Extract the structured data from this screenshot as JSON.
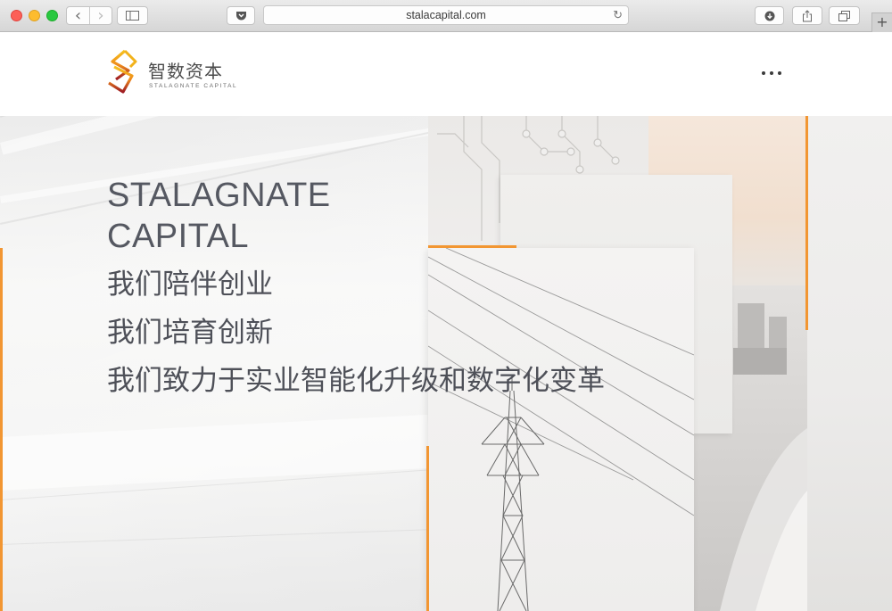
{
  "browser": {
    "url": "stalacapital.com",
    "buttons": {
      "back_icon": "‹",
      "forward_icon": "›",
      "sidebar_icon": "sidebar-icon",
      "pocket_icon": "pocket-icon",
      "download_icon": "download-icon",
      "share_icon": "share-icon",
      "tabs_icon": "tabs-icon",
      "reload_icon": "↻",
      "new_tab": "+"
    }
  },
  "site": {
    "logo": {
      "name_cn": "智数资本",
      "name_en": "STALAGNATE CAPITAL"
    },
    "menu_icon": "more-dots-icon"
  },
  "hero": {
    "title_line1": "STALAGNATE",
    "title_line2": "CAPITAL",
    "taglines": [
      "我们陪伴创业",
      "我们培育创新",
      "我们致力于实业智能化升级和数字化变革"
    ]
  },
  "colors": {
    "accent": "#f29632",
    "text": "#4e5058",
    "logo_gold": "#f2b21b",
    "logo_red": "#9e1b22"
  }
}
